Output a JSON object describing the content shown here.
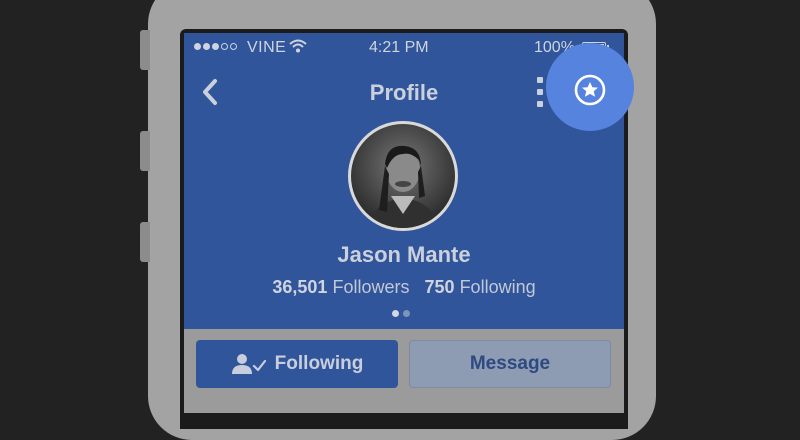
{
  "status_bar": {
    "carrier": "VINE",
    "time": "4:21 PM",
    "battery": "100%",
    "signal_bars_filled": 3,
    "signal_bars_total": 5
  },
  "nav": {
    "title": "Profile",
    "back_icon": "chevron-left-icon",
    "more_icon": "more-vertical-icon",
    "fab_icon": "star-circle-icon"
  },
  "profile": {
    "name": "Jason Mante",
    "followers_count": "36,501",
    "followers_label": "Followers",
    "following_count": "750",
    "following_label": "Following",
    "pages_total": 2,
    "current_page": 1
  },
  "actions": {
    "following_label": "Following",
    "message_label": "Message"
  },
  "colors": {
    "header_blue": "#30559b",
    "fab_blue": "#5583dd",
    "background": "#222222",
    "dim_overlay_gray": "#9b9b9b"
  }
}
